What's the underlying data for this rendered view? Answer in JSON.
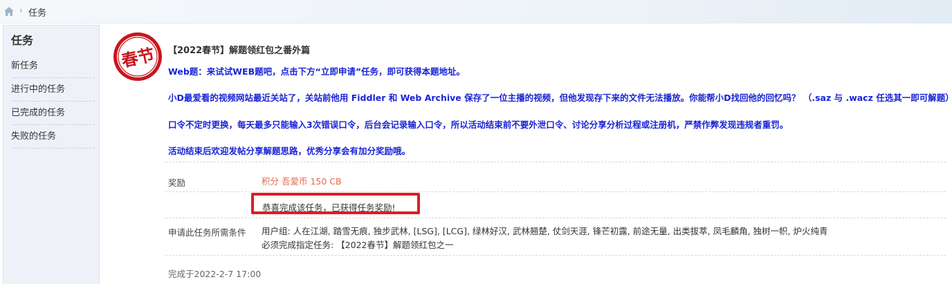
{
  "breadcrumb": {
    "home_icon": "home-icon",
    "separator": "›",
    "current": "任务"
  },
  "sidebar": {
    "title": "任务",
    "items": [
      {
        "label": "新任务"
      },
      {
        "label": "进行中的任务"
      },
      {
        "label": "已完成的任务"
      },
      {
        "label": "失败的任务"
      }
    ]
  },
  "task": {
    "stamp_text": "春节",
    "title": "【2022春节】解题领红包之番外篇",
    "desc": [
      "Web题：来试试WEB题吧，点击下方“立即申请”任务，即可获得本题地址。",
      "小D最爱看的视频网站最近关站了，关站前他用 Fiddler 和 Web Archive 保存了一位主播的视频，但他发现存下来的文件无法播放。你能帮小D找回他的回忆吗？ （.saz 与 .wacz 任选其一即可解题）",
      "口令不定时更换，每天最多只能输入3次错误口令，后台会记录输入口令，所以活动结束前不要外泄口令、讨论分享分析过程或注册机，严禁作弊发现违规者重罚。",
      "活动结束后欢迎发帖分享解题思路，优秀分享会有加分奖励哦。"
    ],
    "reward_label": "奖励",
    "reward_value": "积分 吾爱币 150 CB",
    "notice": "恭喜完成该任务，已获得任务奖励!",
    "cond_label": "申请此任务所需条件",
    "cond_line1": "用户组: 人在江湖, 踏雪无痕, 独步武林, [LSG], [LCG], 绿林好汉, 武林翘楚, 仗剑天涯, 锋芒初露, 前途无量, 出类拔萃, 凤毛麟角, 独树一帜, 炉火纯青",
    "cond_line2": "必须完成指定任务: 【2022春节】解题领红包之一",
    "completed": "完成于2022-2-7 17:00"
  },
  "colors": {
    "desc_blue": "#1a24d6",
    "reward_orange": "#e8664c",
    "notice_border": "#e11a23",
    "stamp_red": "#c8161d"
  }
}
